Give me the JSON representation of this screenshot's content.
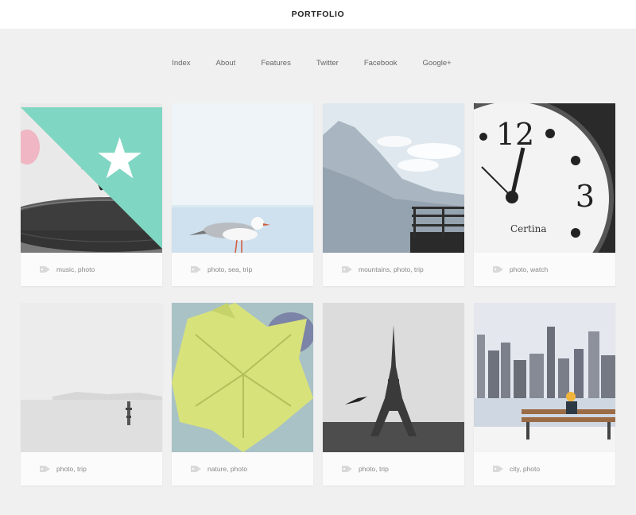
{
  "header": {
    "title": "PORTFOLIO"
  },
  "nav": {
    "items": [
      "Index",
      "About",
      "Features",
      "Twitter",
      "Facebook",
      "Google+"
    ]
  },
  "grid": {
    "cards": [
      {
        "subject": "turntable",
        "tags": "music, photo",
        "featured": true
      },
      {
        "subject": "seagull",
        "tags": "photo, sea, trip",
        "featured": false
      },
      {
        "subject": "mountains",
        "tags": "mountains, photo, trip",
        "featured": false
      },
      {
        "subject": "clock",
        "tags": "photo, watch",
        "featured": false
      },
      {
        "subject": "foggy-sea",
        "tags": "photo, trip",
        "featured": false
      },
      {
        "subject": "leaf",
        "tags": "nature, photo",
        "featured": false
      },
      {
        "subject": "eiffel-tower",
        "tags": "photo, trip",
        "featured": false
      },
      {
        "subject": "city-bench",
        "tags": "city, photo",
        "featured": false
      }
    ]
  },
  "colors": {
    "accent": "#7fd6c2",
    "background": "#f0f0f0",
    "card": "#fbfbfb"
  }
}
